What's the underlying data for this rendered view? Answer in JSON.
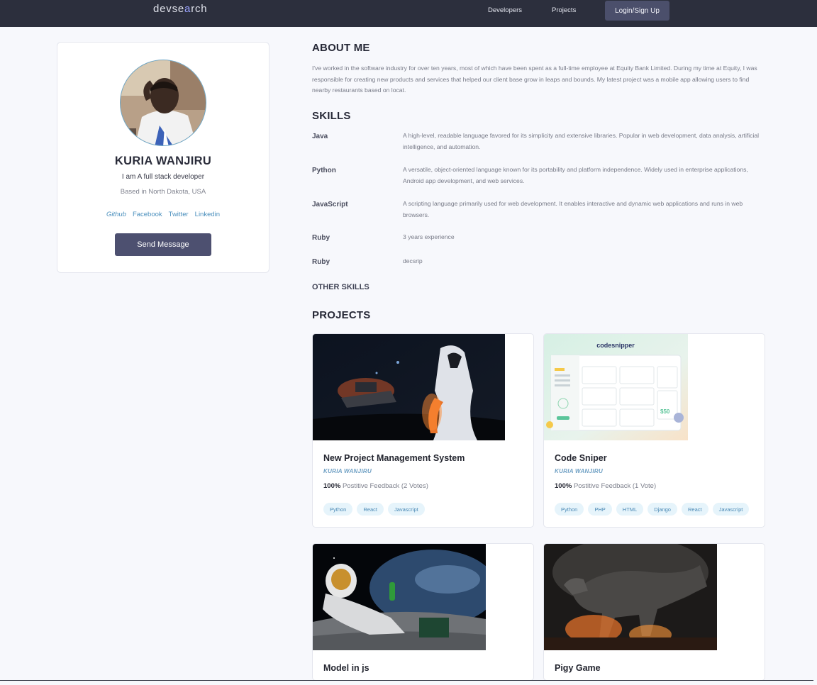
{
  "header": {
    "logo_prefix": "devse",
    "logo_mark": "a",
    "logo_suffix": "rch",
    "nav": [
      "Developers",
      "Projects"
    ],
    "login_label": "Login/Sign Up"
  },
  "profile": {
    "name": "KURIA WANJIRU",
    "role": "I am A full stack developer",
    "location": "Based in North Dakota, USA",
    "socials": [
      "Github",
      "Facebook",
      "Twitter",
      "Linkedin"
    ],
    "send_label": "Send Message"
  },
  "about": {
    "title": "ABOUT ME",
    "text": "I've worked in the software industry for over ten years, most of which have been spent as a full-time employee at Equity Bank Limited. During my time at Equity, I was responsible for creating new products and services that helped our client base grow in leaps and bounds. My latest project was a mobile app allowing users to find nearby restaurants based on locat."
  },
  "skills": {
    "title": "SKILLS",
    "items": [
      {
        "name": "Java",
        "desc": "A high-level, readable language favored for its simplicity and extensive libraries. Popular in web development, data analysis, artificial intelligence, and automation."
      },
      {
        "name": "Python",
        "desc": "A versatile, object-oriented language known for its portability and platform independence. Widely used in enterprise applications, Android app development, and web services."
      },
      {
        "name": "JavaScript",
        "desc": "A scripting language primarily used for web development. It enables interactive and dynamic web applications and runs in web browsers."
      },
      {
        "name": "Ruby",
        "desc": "3 years experience"
      },
      {
        "name": "Ruby",
        "desc": "decsrip"
      }
    ],
    "other_title": "OTHER SKILLS"
  },
  "projects": {
    "title": "PROJECTS",
    "items": [
      {
        "title": "New Project Management System",
        "author": "KURIA WANJIRU",
        "percent": "100%",
        "feedback": "Postitive Feedback (2 Votes)",
        "tags": [
          "Python",
          "React",
          "Javascript"
        ]
      },
      {
        "title": "Code Sniper",
        "author": "KURIA WANJIRU",
        "percent": "100%",
        "feedback": "Postitive Feedback (1 Vote)",
        "tags": [
          "Python",
          "PHP",
          "HTML",
          "Django",
          "React",
          "Javascript"
        ],
        "image_logo": "codesnipper",
        "image_price": "$50"
      },
      {
        "title": "Model in js"
      },
      {
        "title": "Pigy Game"
      }
    ]
  }
}
